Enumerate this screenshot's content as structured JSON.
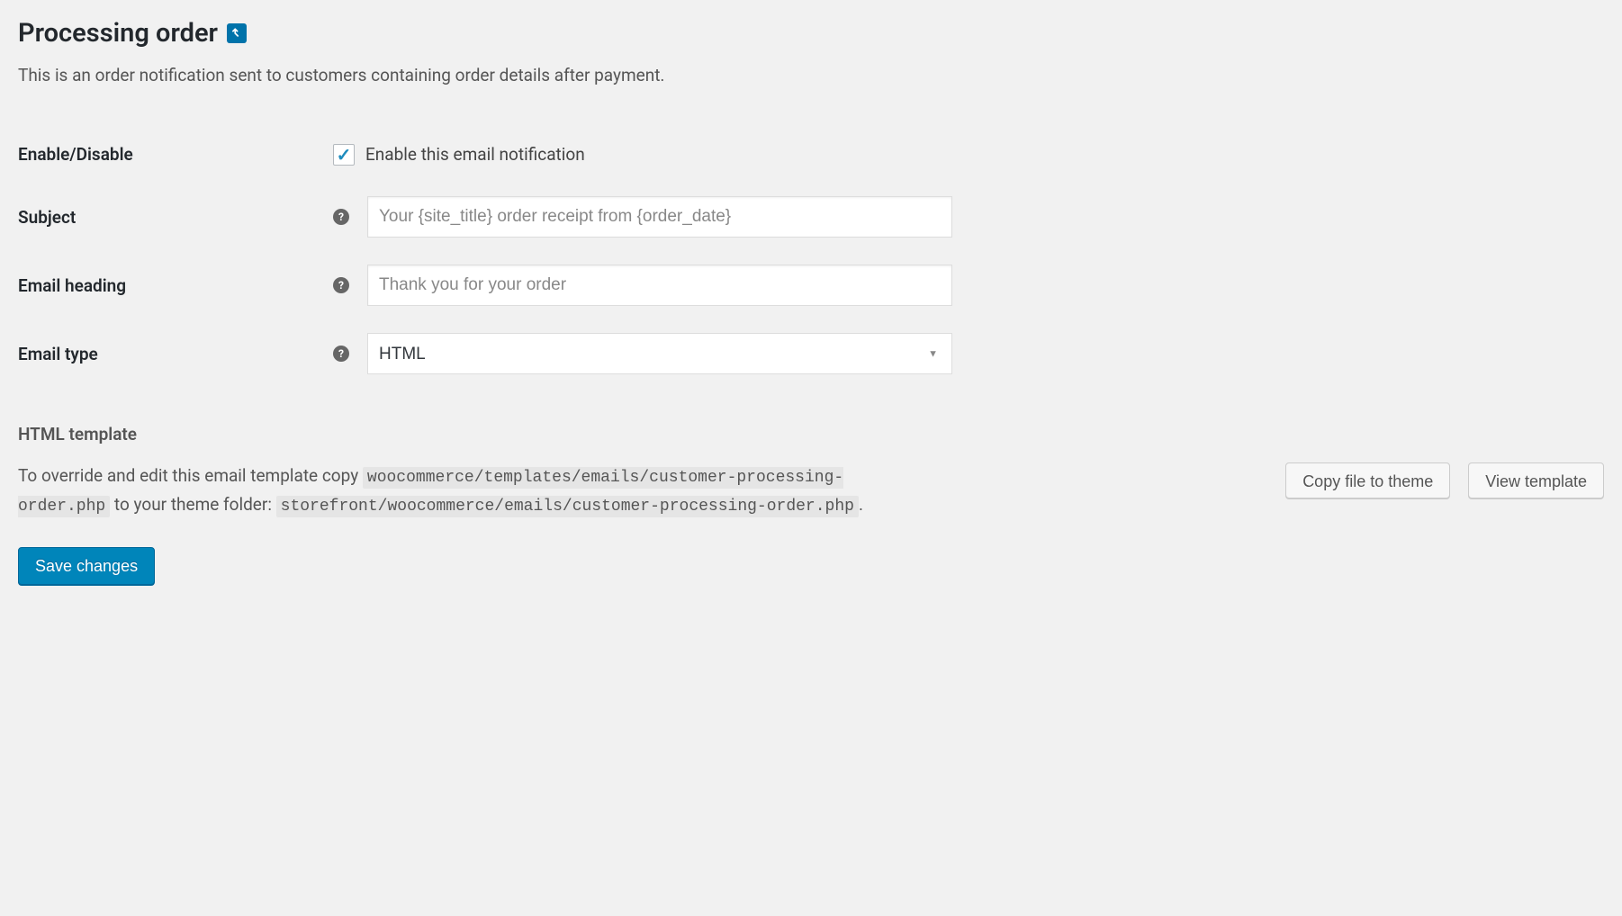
{
  "page": {
    "title": "Processing order",
    "description": "This is an order notification sent to customers containing order details after payment."
  },
  "form": {
    "enable": {
      "label": "Enable/Disable",
      "checkbox_label": "Enable this email notification",
      "checked": true
    },
    "subject": {
      "label": "Subject",
      "placeholder": "Your {site_title} order receipt from {order_date}",
      "value": ""
    },
    "email_heading": {
      "label": "Email heading",
      "placeholder": "Thank you for your order",
      "value": ""
    },
    "email_type": {
      "label": "Email type",
      "selected": "HTML"
    }
  },
  "template": {
    "heading": "HTML template",
    "text_prefix": "To override and edit this email template copy ",
    "code1": "woocommerce/templates/emails/customer-processing-order.php",
    "text_mid": " to your theme folder: ",
    "code2": "storefront/woocommerce/emails/customer-processing-order.php",
    "text_suffix": ".",
    "copy_button": "Copy file to theme",
    "view_button": "View template"
  },
  "submit": {
    "label": "Save changes"
  }
}
